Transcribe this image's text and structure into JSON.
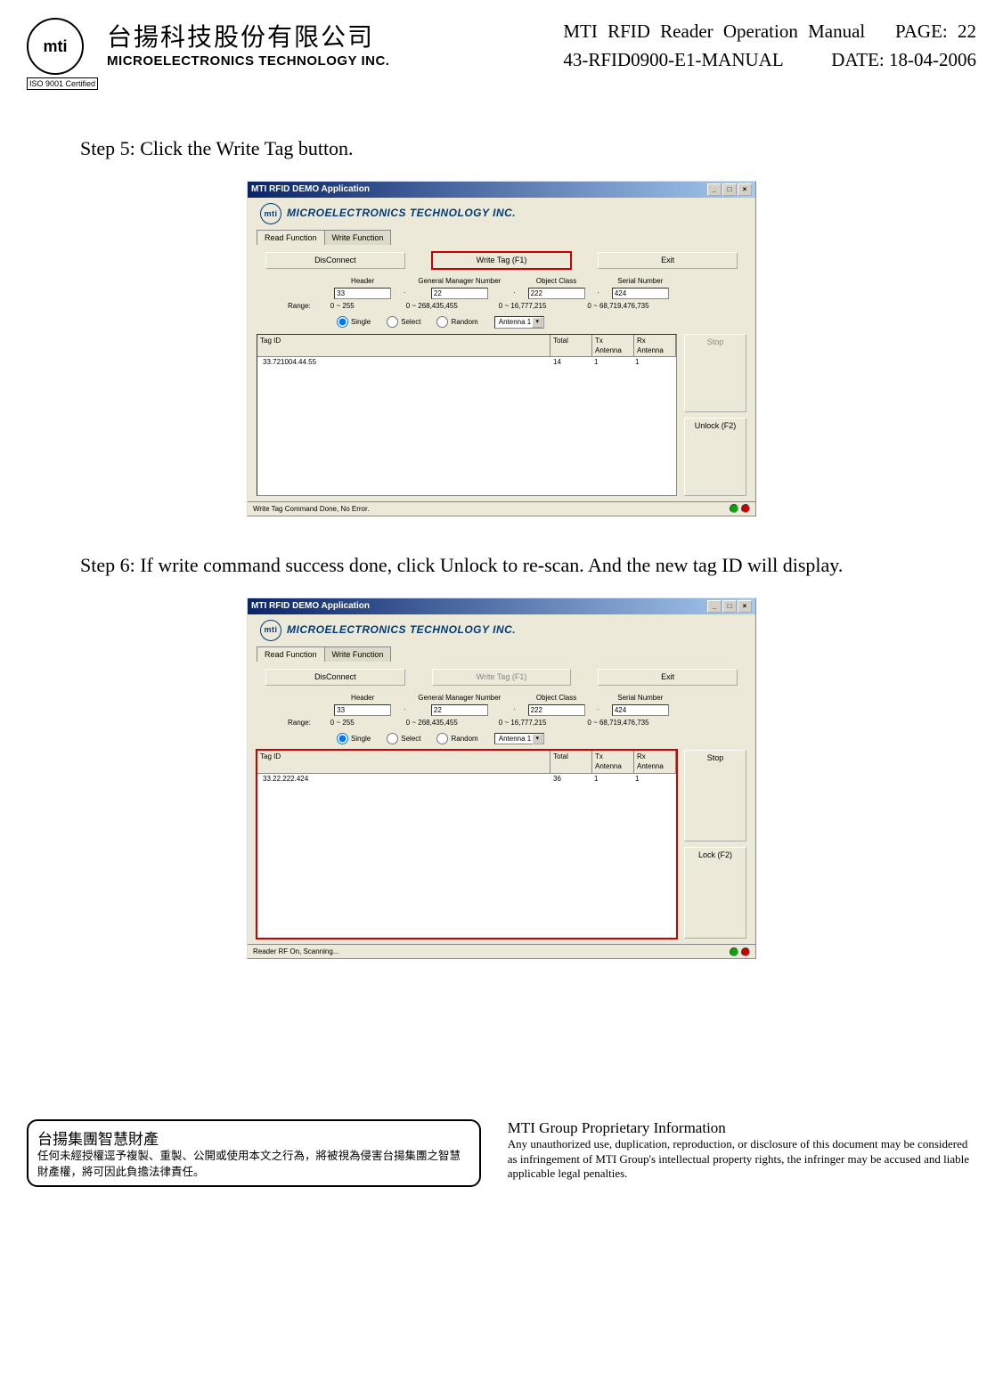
{
  "header": {
    "logo_text": "mti",
    "iso": "ISO 9001 Certified",
    "company_cn": "台揚科技股份有限公司",
    "company_en": "MICROELECTRONICS TECHNOLOGY INC.",
    "doc_title": "MTI RFID Reader Operation Manual",
    "page_label": "PAGE: 22",
    "doc_no": "43-RFID0900-E1-MANUAL",
    "date": "DATE: 18-04-2006"
  },
  "step5_title": "Step 5: Click the Write Tag button.",
  "step6_title": "Step 6: If write command success done, click Unlock to re-scan. And the new tag ID will display.",
  "app": {
    "window_title": "MTI RFID DEMO Application",
    "logo_text": "mti",
    "banner": "MICROELECTRONICS TECHNOLOGY INC.",
    "tab_read": "Read Function",
    "tab_write": "Write Function",
    "btn_disconnect": "DisConnect",
    "btn_write_tag": "Write Tag (F1)",
    "btn_exit": "Exit",
    "fields": {
      "header_label": "Header",
      "header_val": "33",
      "gmn_label": "General Manager Number",
      "gmn_val": "22",
      "oc_label": "Object Class",
      "oc_val": "222",
      "sn_label": "Serial Number",
      "sn_val": "424"
    },
    "ranges": {
      "label": "Range:",
      "r1": "0 ~ 255",
      "r2": "0 ~ 268,435,455",
      "r3": "0 ~ 16,777,215",
      "r4": "0 ~ 68,719,476,735"
    },
    "radio": {
      "single": "Single",
      "select": "Select",
      "random": "Random",
      "antenna": "Antenna 1"
    },
    "listview": {
      "col_tag": "Tag ID",
      "col_total": "Total",
      "col_tx": "Tx Antenna",
      "col_rx": "Rx Antenna"
    },
    "side": {
      "stop": "Stop",
      "unlock": "Unlock  (F2)",
      "lock": "Lock (F2)"
    }
  },
  "win1": {
    "row_tag": "33.721004.44.55",
    "row_total": "14",
    "row_tx": "1",
    "row_rx": "1",
    "status": "Write Tag Command Done, No Error."
  },
  "win2": {
    "row_tag": "33.22.222.424",
    "row_total": "36",
    "row_tx": "1",
    "row_rx": "1",
    "status": "Reader RF On, Scanning..."
  },
  "footer": {
    "left_title": "台揚集團智慧財產",
    "left_body": "任何未經授權逕予複製、重製、公開或使用本文之行為，將被視為侵害台揚集團之智慧財產權，將可因此負擔法律責任。",
    "right_title": "MTI Group Proprietary Information",
    "right_body": "Any unauthorized use, duplication, reproduction, or disclosure of this document may be considered as infringement of MTI Group's intellectual property rights, the infringer may be accused and liable applicable legal penalties."
  }
}
